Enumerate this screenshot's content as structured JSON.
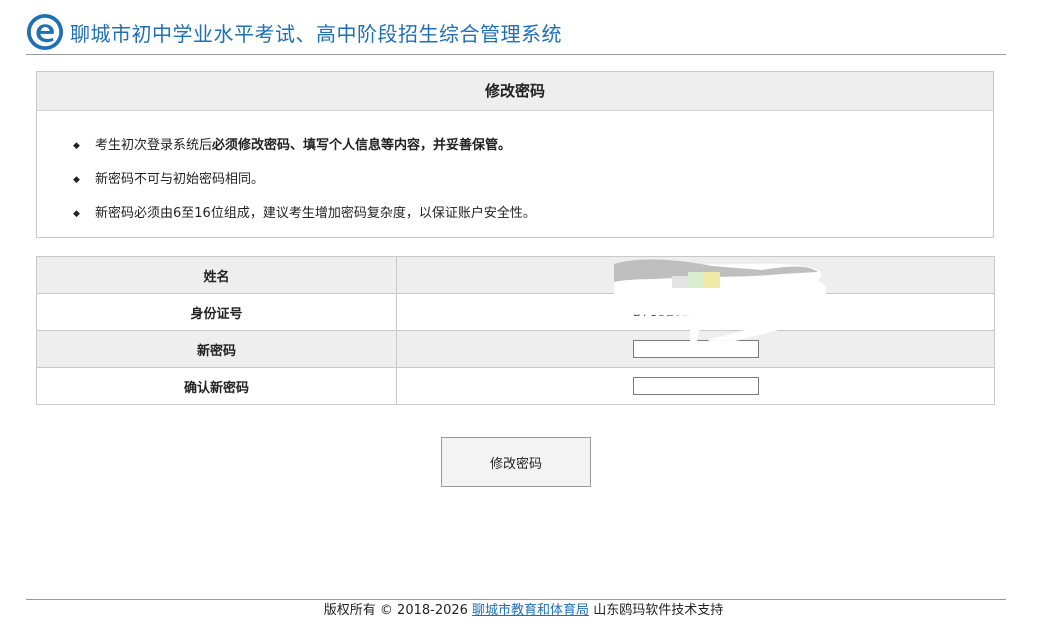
{
  "header": {
    "title": "聊城市初中学业水平考试、高中阶段招生综合管理系统",
    "logo_icon": "e-logo-icon",
    "title_color": "#1f6fb5"
  },
  "notice": {
    "title": "修改密码",
    "items": [
      {
        "prefix": "考生初次登录系统后",
        "bold": "必须修改密码、填写个人信息等内容，并妥善保管。"
      },
      {
        "prefix": "新密码不可与初始密码相同。",
        "bold": ""
      },
      {
        "prefix": "新密码必须由6至16位组成，建议考生增加密码复杂度，以保证账户安全性。",
        "bold": ""
      }
    ]
  },
  "form": {
    "rows": {
      "name": {
        "label": "姓名",
        "value": ""
      },
      "id": {
        "label": "身份证号",
        "value": "37152520"
      },
      "new_password": {
        "label": "新密码",
        "value": ""
      },
      "confirm_password": {
        "label": "确认新密码",
        "value": ""
      }
    }
  },
  "actions": {
    "submit_label": "修改密码"
  },
  "footer": {
    "copyright": "版权所有 © 2018-2026",
    "link_text": "聊城市教育和体育局",
    "support": "山东鸥玛软件技术支持",
    "link_color": "#1f6fb5"
  }
}
